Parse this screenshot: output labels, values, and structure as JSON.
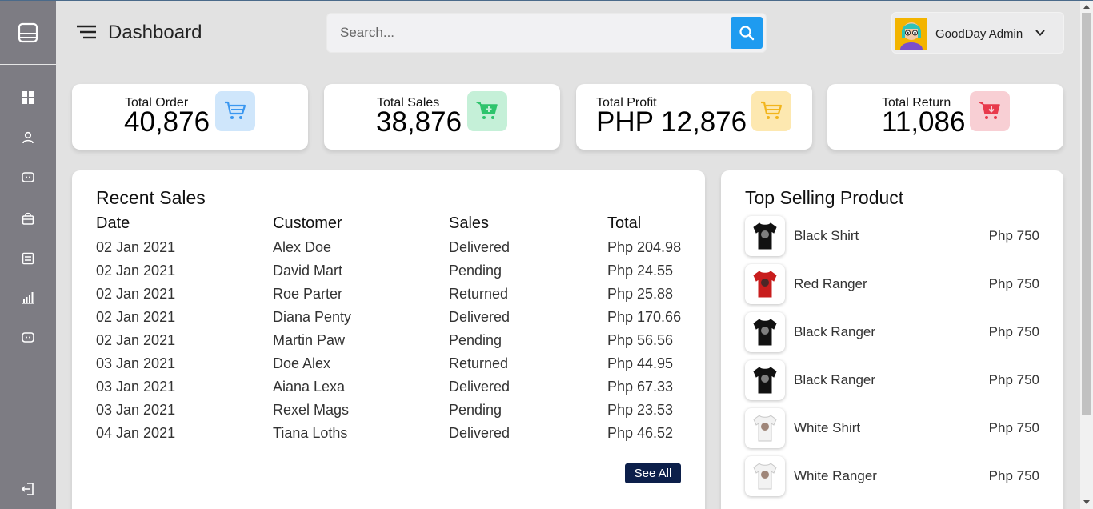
{
  "header": {
    "title": "Dashboard",
    "search_placeholder": "Search...",
    "user_name": "GoodDay Admin"
  },
  "sidebar": {
    "items": [
      {
        "icon": "dashboard-grid-icon"
      },
      {
        "icon": "user-icon"
      },
      {
        "icon": "chat-icon"
      },
      {
        "icon": "shopping-bag-icon"
      },
      {
        "icon": "list-icon"
      },
      {
        "icon": "bar-chart-icon"
      },
      {
        "icon": "chat-icon"
      }
    ],
    "logout_icon": "logout-icon"
  },
  "cards": [
    {
      "label": "Total Order",
      "value": "40,876",
      "icon": "cart-icon",
      "icon_bg": "#cfe6fb",
      "icon_color": "#3a97f0"
    },
    {
      "label": "Total Sales",
      "value": "38,876",
      "icon": "cart-plus-icon",
      "icon_bg": "#c5f0d8",
      "icon_color": "#2fc46d"
    },
    {
      "label": "Total Profit",
      "value": "PHP 12,876",
      "icon": "cart-icon",
      "icon_bg": "#fde8b0",
      "icon_color": "#f2b51c"
    },
    {
      "label": "Total Return",
      "value": "11,086",
      "icon": "cart-return-icon",
      "icon_bg": "#f8cfd4",
      "icon_color": "#e83a4c"
    }
  ],
  "recent_sales": {
    "title": "Recent Sales",
    "columns": [
      "Date",
      "Customer",
      "Sales",
      "Total"
    ],
    "rows": [
      [
        "02 Jan 2021",
        "Alex Doe",
        "Delivered",
        "Php 204.98"
      ],
      [
        "02 Jan 2021",
        "David Mart",
        "Pending",
        "Php 24.55"
      ],
      [
        "02 Jan 2021",
        "Roe Parter",
        "Returned",
        "Php 25.88"
      ],
      [
        "02 Jan 2021",
        "Diana Penty",
        "Delivered",
        "Php 170.66"
      ],
      [
        "02 Jan 2021",
        "Martin Paw",
        "Pending",
        "Php 56.56"
      ],
      [
        "03 Jan 2021",
        "Doe Alex",
        "Returned",
        "Php 44.95"
      ],
      [
        "03 Jan 2021",
        "Aiana Lexa",
        "Delivered",
        "Php 67.33"
      ],
      [
        "03 Jan 2021",
        "Rexel Mags",
        "Pending",
        "Php 23.53"
      ],
      [
        "04 Jan 2021",
        "Tiana Loths",
        "Delivered",
        "Php 46.52"
      ]
    ],
    "see_all_label": "See All"
  },
  "top_selling": {
    "title": "Top Selling Product",
    "products": [
      {
        "name": "Black Shirt",
        "price": "Php 750",
        "shirt_color": "#111111"
      },
      {
        "name": "Red Ranger",
        "price": "Php 750",
        "shirt_color": "#c81d1d"
      },
      {
        "name": "Black Ranger",
        "price": "Php 750",
        "shirt_color": "#111111"
      },
      {
        "name": "Black Ranger",
        "price": "Php 750",
        "shirt_color": "#111111"
      },
      {
        "name": "White Shirt",
        "price": "Php 750",
        "shirt_color": "#f2f2f2"
      },
      {
        "name": "White Ranger",
        "price": "Php 750",
        "shirt_color": "#f2f2f2"
      }
    ]
  }
}
